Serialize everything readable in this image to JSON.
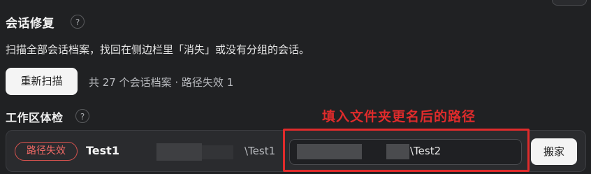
{
  "repair": {
    "title": "会话修复",
    "help_glyph": "?",
    "description": "扫描全部会话档案，找回在侧边栏里「消失」或没有分组的会话。",
    "rescan_label": "重新扫描",
    "summary": "共 27 个会话档案 · 路径失效 1"
  },
  "workspace": {
    "title": "工作区体检",
    "help_glyph": "?",
    "row": {
      "status_badge": "路径失效",
      "name": "Test1",
      "old_path_suffix": "\\Test1",
      "new_path_suffix": "\\Test2",
      "move_label": "搬家"
    }
  },
  "annotation": {
    "text": "填入文件夹更名后的路径",
    "color": "#e02b2b"
  },
  "colors": {
    "background": "#202123",
    "panel": "#2a2b2e",
    "error": "#f06a66"
  }
}
